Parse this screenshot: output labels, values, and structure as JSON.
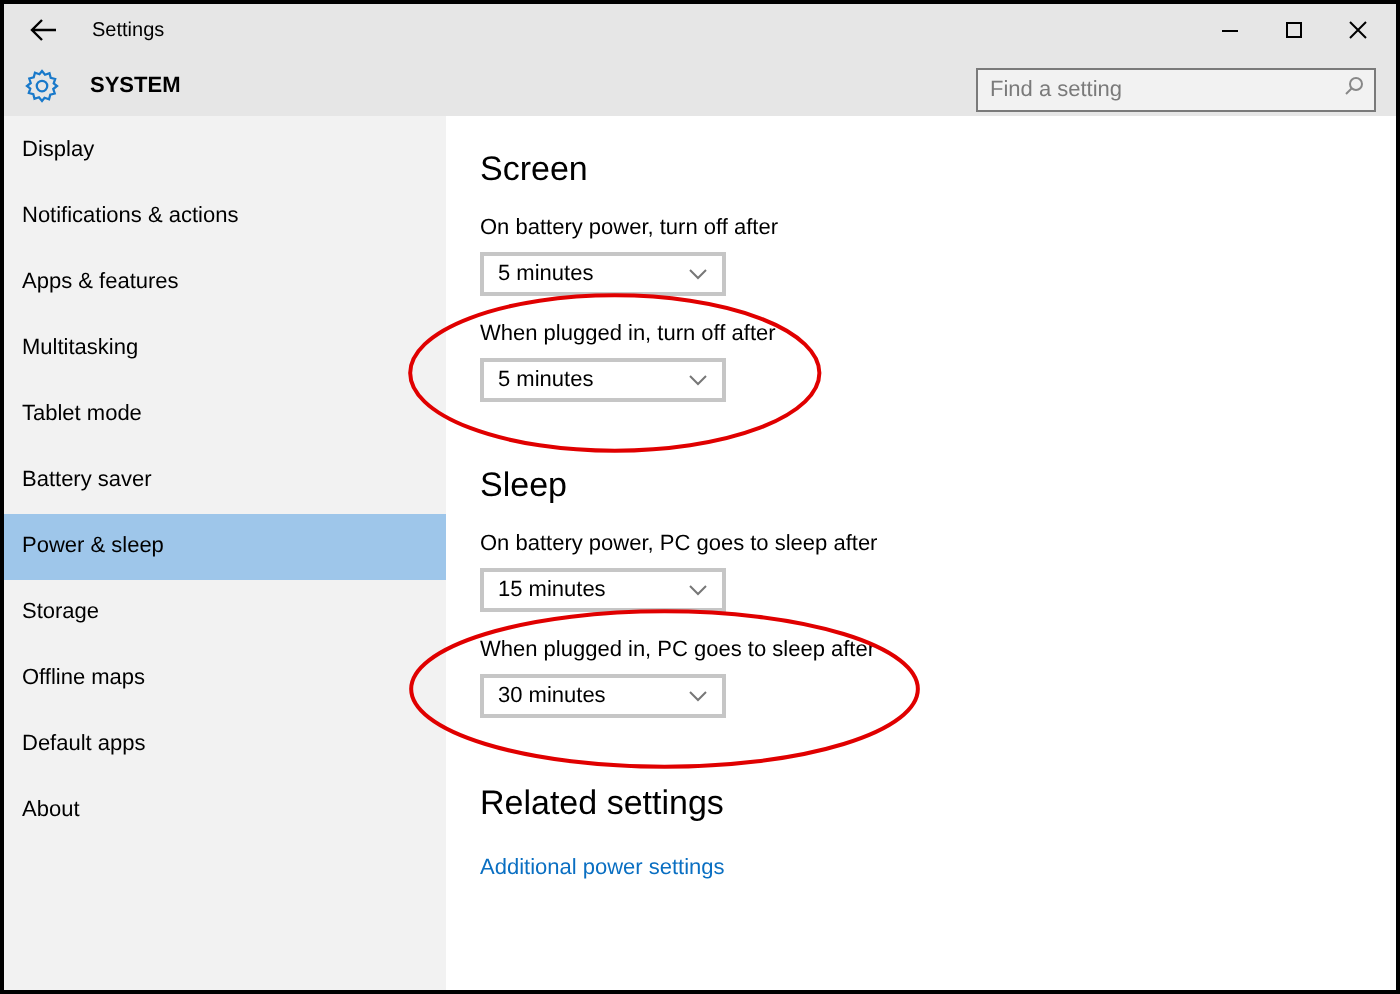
{
  "window": {
    "title": "Settings"
  },
  "header": {
    "title": "SYSTEM",
    "search": {
      "placeholder": "Find a setting"
    }
  },
  "sidebar": {
    "items": [
      {
        "label": "Display",
        "selected": false
      },
      {
        "label": "Notifications & actions",
        "selected": false
      },
      {
        "label": "Apps & features",
        "selected": false
      },
      {
        "label": "Multitasking",
        "selected": false
      },
      {
        "label": "Tablet mode",
        "selected": false
      },
      {
        "label": "Battery saver",
        "selected": false
      },
      {
        "label": "Power & sleep",
        "selected": true
      },
      {
        "label": "Storage",
        "selected": false
      },
      {
        "label": "Offline maps",
        "selected": false
      },
      {
        "label": "Default apps",
        "selected": false
      },
      {
        "label": "About",
        "selected": false
      }
    ]
  },
  "sections": [
    {
      "title": "Screen",
      "settings": [
        {
          "label": "On battery power, turn off after",
          "value": "5 minutes",
          "circled": false
        },
        {
          "label": "When plugged in, turn off after",
          "value": "5 minutes",
          "circled": true
        }
      ]
    },
    {
      "title": "Sleep",
      "settings": [
        {
          "label": "On battery power, PC goes to sleep after",
          "value": "15 minutes",
          "circled": false
        },
        {
          "label": "When plugged in, PC goes to sleep after",
          "value": "30 minutes",
          "circled": true
        }
      ]
    }
  ],
  "related": {
    "title": "Related settings",
    "links": [
      "Additional power settings"
    ]
  }
}
